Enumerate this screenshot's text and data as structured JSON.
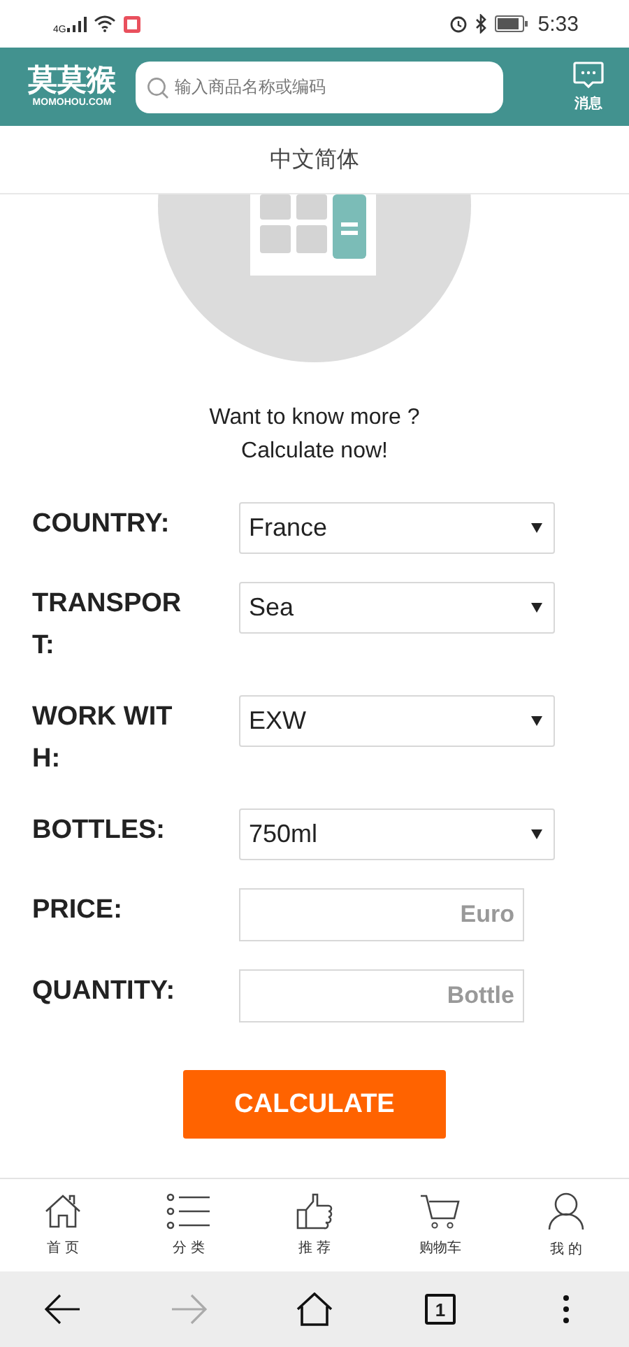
{
  "status_bar": {
    "network": "4G",
    "time": "5:33"
  },
  "header": {
    "logo": "莫莫猴",
    "logo_sub": "MOMOHOU.COM",
    "search": {
      "placeholder": "输入商品名称或编码"
    },
    "message_label": "消息"
  },
  "language": "中文简体",
  "intro": [
    "Want to know more ?",
    "Calculate now!"
  ],
  "form": [
    {
      "label": "COUNTRY:",
      "kind": "select",
      "value": "France"
    },
    {
      "label": "TRANSPORT:",
      "kind": "select",
      "value": "Sea"
    },
    {
      "label": "WORK WITH:",
      "kind": "select",
      "value": "EXW"
    },
    {
      "label": "BOTTLES:",
      "kind": "select",
      "value": "750ml"
    },
    {
      "label": "PRICE:",
      "kind": "input",
      "placeholder": "Euro"
    },
    {
      "label": "QUANTITY:",
      "kind": "input",
      "placeholder": "Bottle"
    }
  ],
  "calculate_button": "CALCULATE",
  "bottom_nav": [
    {
      "label": "首 页",
      "kind": "home"
    },
    {
      "label": "分 类",
      "kind": "list"
    },
    {
      "label": "推 荐",
      "kind": "thumb"
    },
    {
      "label": "购物车",
      "kind": "cart"
    },
    {
      "label": "我 的",
      "kind": "user"
    }
  ],
  "browser_bar": [
    {
      "kind": "back",
      "disabled": false
    },
    {
      "kind": "forward",
      "disabled": true
    },
    {
      "kind": "home",
      "disabled": false
    },
    {
      "kind": "tabs",
      "count": "1",
      "disabled": false
    },
    {
      "kind": "more",
      "disabled": false
    }
  ]
}
